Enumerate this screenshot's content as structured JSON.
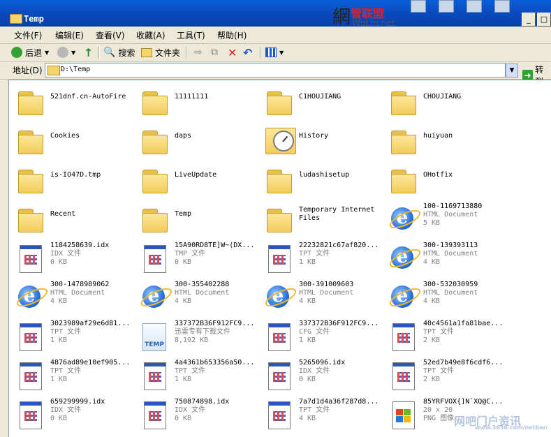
{
  "window": {
    "title": "Temp"
  },
  "brand": {
    "glyph": "網",
    "name": "管联盟",
    "domain": "WgLm.net"
  },
  "menu": [
    "文件(F)",
    "编辑(E)",
    "查看(V)",
    "收藏(A)",
    "工具(T)",
    "帮助(H)"
  ],
  "toolbar": {
    "back": "后退",
    "search": "搜索",
    "folders": "文件夹"
  },
  "address": {
    "label": "地址(D)",
    "value": "D:\\Temp",
    "go": "转到"
  },
  "items": [
    {
      "name": "521dnf.cn-AutoFire",
      "icon": "folder-icon"
    },
    {
      "name": "11111111",
      "icon": "folder-icon"
    },
    {
      "name": "C1HOUJIANG",
      "icon": "folder-icon"
    },
    {
      "name": "CHOUJIANG",
      "icon": "folder-icon"
    },
    {
      "name": "Cookies",
      "icon": "folder-icon"
    },
    {
      "name": "daps",
      "icon": "folder-icon"
    },
    {
      "name": "History",
      "icon": "history-folder-icon"
    },
    {
      "name": "huiyuan",
      "icon": "folder-icon"
    },
    {
      "name": "is-IO47D.tmp",
      "icon": "folder-icon"
    },
    {
      "name": "LiveUpdate",
      "icon": "folder-icon"
    },
    {
      "name": "ludashisetup",
      "icon": "folder-icon"
    },
    {
      "name": "OHotfix",
      "icon": "folder-icon"
    },
    {
      "name": "Recent",
      "icon": "folder-icon"
    },
    {
      "name": "Temp",
      "icon": "folder-icon"
    },
    {
      "name": "Temporary Internet Files",
      "icon": "folder-icon"
    },
    {
      "name": "100-1169713880",
      "type": "HTML Document",
      "size": "5 KB",
      "icon": "ie-icon"
    },
    {
      "name": "1184258639.idx",
      "type": "IDX 文件",
      "size": "0 KB",
      "icon": "doc-icon"
    },
    {
      "name": "15A90RD8TE]W~(DX...",
      "type": "TMP 文件",
      "size": "0 KB",
      "icon": "doc-icon"
    },
    {
      "name": "22232821c67af820...",
      "type": "TPT 文件",
      "size": "1 KB",
      "icon": "doc-icon"
    },
    {
      "name": "300-139393113",
      "type": "HTML Document",
      "size": "4 KB",
      "icon": "ie-icon"
    },
    {
      "name": "300-1478989062",
      "type": "HTML Document",
      "size": "4 KB",
      "icon": "ie-icon"
    },
    {
      "name": "300-355402288",
      "type": "HTML Document",
      "size": "4 KB",
      "icon": "ie-icon"
    },
    {
      "name": "300-391009603",
      "type": "HTML Document",
      "size": "4 KB",
      "icon": "ie-icon"
    },
    {
      "name": "300-532030959",
      "type": "HTML Document",
      "size": "4 KB",
      "icon": "ie-icon"
    },
    {
      "name": "3023989af29e6d81...",
      "type": "TPT 文件",
      "size": "1 KB",
      "icon": "doc-icon"
    },
    {
      "name": "337372B36F912FC9...",
      "type": "迅雷专有下载文件",
      "size": "8,192 KB",
      "icon": "temp-file-icon"
    },
    {
      "name": "337372B36F912FC9...",
      "type": "CFG 文件",
      "size": "1 KB",
      "icon": "doc-icon"
    },
    {
      "name": "40c4561a1fa81bae...",
      "type": "TPT 文件",
      "size": "2 KB",
      "icon": "doc-icon"
    },
    {
      "name": "4876ad89e10ef905...",
      "type": "TPT 文件",
      "size": "1 KB",
      "icon": "doc-icon"
    },
    {
      "name": "4a4361b653356a50...",
      "type": "TPT 文件",
      "size": "1 KB",
      "icon": "doc-icon"
    },
    {
      "name": "5265096.idx",
      "type": "IDX 文件",
      "size": "0 KB",
      "icon": "doc-icon"
    },
    {
      "name": "52ed7b49e8f6cdf6...",
      "type": "TPT 文件",
      "size": "2 KB",
      "icon": "doc-icon"
    },
    {
      "name": "659299999.idx",
      "type": "IDX 文件",
      "size": "0 KB",
      "icon": "doc-icon"
    },
    {
      "name": "750874898.idx",
      "type": "IDX 文件",
      "size": "0 KB",
      "icon": "doc-icon"
    },
    {
      "name": "7a7d1d4a36f287d8...",
      "type": "TPT 文件",
      "size": "4 KB",
      "icon": "doc-icon"
    },
    {
      "name": "85YRFVOX{]N`XQ@C...",
      "type": "20 x 20",
      "size": "PNG 图像",
      "icon": "png-icon"
    }
  ],
  "watermark": {
    "text": "网吧门户资讯",
    "sub": "www.3636.com/netbar/"
  }
}
